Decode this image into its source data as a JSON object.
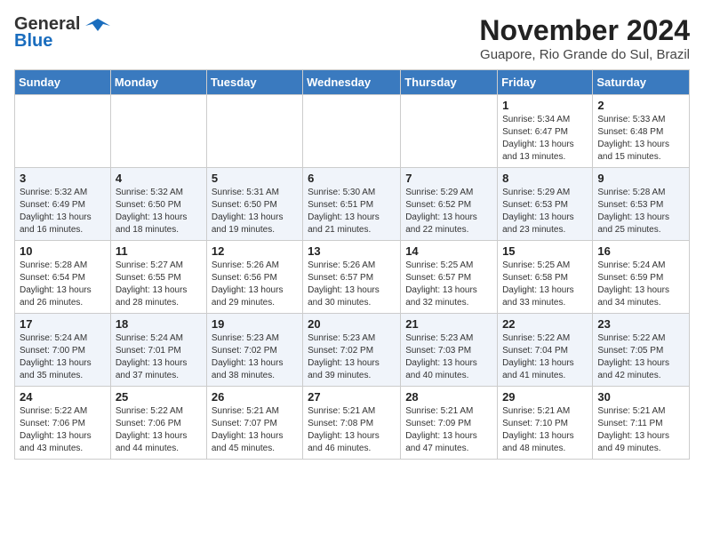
{
  "logo": {
    "line1": "General",
    "line2": "Blue"
  },
  "title": "November 2024",
  "subtitle": "Guapore, Rio Grande do Sul, Brazil",
  "days_of_week": [
    "Sunday",
    "Monday",
    "Tuesday",
    "Wednesday",
    "Thursday",
    "Friday",
    "Saturday"
  ],
  "weeks": [
    [
      {
        "day": "",
        "info": ""
      },
      {
        "day": "",
        "info": ""
      },
      {
        "day": "",
        "info": ""
      },
      {
        "day": "",
        "info": ""
      },
      {
        "day": "",
        "info": ""
      },
      {
        "day": "1",
        "info": "Sunrise: 5:34 AM\nSunset: 6:47 PM\nDaylight: 13 hours\nand 13 minutes."
      },
      {
        "day": "2",
        "info": "Sunrise: 5:33 AM\nSunset: 6:48 PM\nDaylight: 13 hours\nand 15 minutes."
      }
    ],
    [
      {
        "day": "3",
        "info": "Sunrise: 5:32 AM\nSunset: 6:49 PM\nDaylight: 13 hours\nand 16 minutes."
      },
      {
        "day": "4",
        "info": "Sunrise: 5:32 AM\nSunset: 6:50 PM\nDaylight: 13 hours\nand 18 minutes."
      },
      {
        "day": "5",
        "info": "Sunrise: 5:31 AM\nSunset: 6:50 PM\nDaylight: 13 hours\nand 19 minutes."
      },
      {
        "day": "6",
        "info": "Sunrise: 5:30 AM\nSunset: 6:51 PM\nDaylight: 13 hours\nand 21 minutes."
      },
      {
        "day": "7",
        "info": "Sunrise: 5:29 AM\nSunset: 6:52 PM\nDaylight: 13 hours\nand 22 minutes."
      },
      {
        "day": "8",
        "info": "Sunrise: 5:29 AM\nSunset: 6:53 PM\nDaylight: 13 hours\nand 23 minutes."
      },
      {
        "day": "9",
        "info": "Sunrise: 5:28 AM\nSunset: 6:53 PM\nDaylight: 13 hours\nand 25 minutes."
      }
    ],
    [
      {
        "day": "10",
        "info": "Sunrise: 5:28 AM\nSunset: 6:54 PM\nDaylight: 13 hours\nand 26 minutes."
      },
      {
        "day": "11",
        "info": "Sunrise: 5:27 AM\nSunset: 6:55 PM\nDaylight: 13 hours\nand 28 minutes."
      },
      {
        "day": "12",
        "info": "Sunrise: 5:26 AM\nSunset: 6:56 PM\nDaylight: 13 hours\nand 29 minutes."
      },
      {
        "day": "13",
        "info": "Sunrise: 5:26 AM\nSunset: 6:57 PM\nDaylight: 13 hours\nand 30 minutes."
      },
      {
        "day": "14",
        "info": "Sunrise: 5:25 AM\nSunset: 6:57 PM\nDaylight: 13 hours\nand 32 minutes."
      },
      {
        "day": "15",
        "info": "Sunrise: 5:25 AM\nSunset: 6:58 PM\nDaylight: 13 hours\nand 33 minutes."
      },
      {
        "day": "16",
        "info": "Sunrise: 5:24 AM\nSunset: 6:59 PM\nDaylight: 13 hours\nand 34 minutes."
      }
    ],
    [
      {
        "day": "17",
        "info": "Sunrise: 5:24 AM\nSunset: 7:00 PM\nDaylight: 13 hours\nand 35 minutes."
      },
      {
        "day": "18",
        "info": "Sunrise: 5:24 AM\nSunset: 7:01 PM\nDaylight: 13 hours\nand 37 minutes."
      },
      {
        "day": "19",
        "info": "Sunrise: 5:23 AM\nSunset: 7:02 PM\nDaylight: 13 hours\nand 38 minutes."
      },
      {
        "day": "20",
        "info": "Sunrise: 5:23 AM\nSunset: 7:02 PM\nDaylight: 13 hours\nand 39 minutes."
      },
      {
        "day": "21",
        "info": "Sunrise: 5:23 AM\nSunset: 7:03 PM\nDaylight: 13 hours\nand 40 minutes."
      },
      {
        "day": "22",
        "info": "Sunrise: 5:22 AM\nSunset: 7:04 PM\nDaylight: 13 hours\nand 41 minutes."
      },
      {
        "day": "23",
        "info": "Sunrise: 5:22 AM\nSunset: 7:05 PM\nDaylight: 13 hours\nand 42 minutes."
      }
    ],
    [
      {
        "day": "24",
        "info": "Sunrise: 5:22 AM\nSunset: 7:06 PM\nDaylight: 13 hours\nand 43 minutes."
      },
      {
        "day": "25",
        "info": "Sunrise: 5:22 AM\nSunset: 7:06 PM\nDaylight: 13 hours\nand 44 minutes."
      },
      {
        "day": "26",
        "info": "Sunrise: 5:21 AM\nSunset: 7:07 PM\nDaylight: 13 hours\nand 45 minutes."
      },
      {
        "day": "27",
        "info": "Sunrise: 5:21 AM\nSunset: 7:08 PM\nDaylight: 13 hours\nand 46 minutes."
      },
      {
        "day": "28",
        "info": "Sunrise: 5:21 AM\nSunset: 7:09 PM\nDaylight: 13 hours\nand 47 minutes."
      },
      {
        "day": "29",
        "info": "Sunrise: 5:21 AM\nSunset: 7:10 PM\nDaylight: 13 hours\nand 48 minutes."
      },
      {
        "day": "30",
        "info": "Sunrise: 5:21 AM\nSunset: 7:11 PM\nDaylight: 13 hours\nand 49 minutes."
      }
    ]
  ]
}
